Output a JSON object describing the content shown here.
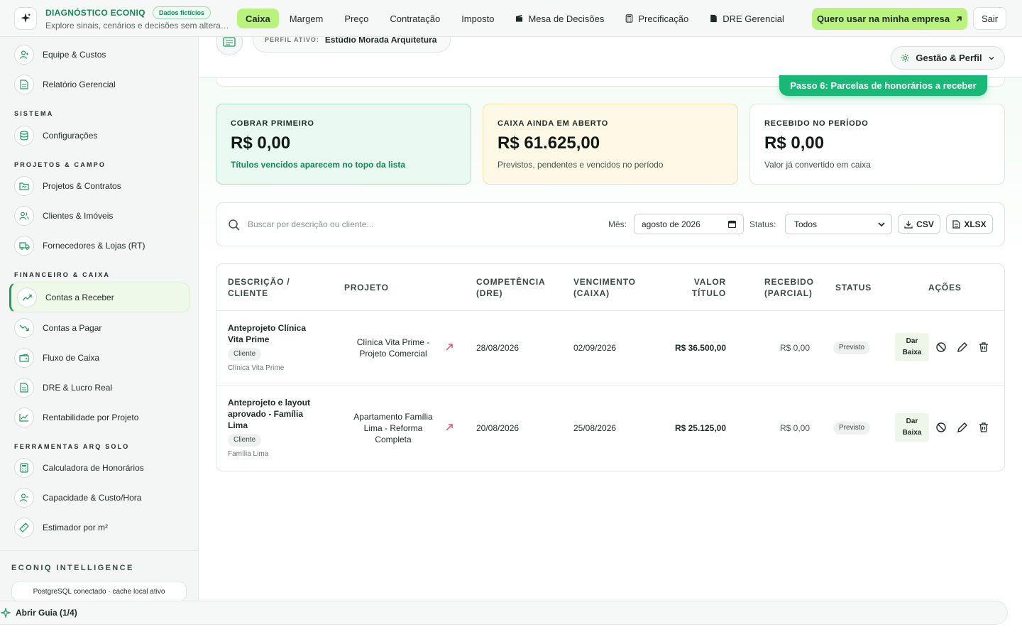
{
  "header": {
    "brand_title": "DIAGNÓSTICO ECONIQ",
    "badge": "Dados fictícios",
    "subtitle": "Explore sinais, cenários e decisões sem alterar dados reais",
    "nav": [
      {
        "label": "Caixa",
        "active": true
      },
      {
        "label": "Margem"
      },
      {
        "label": "Preço"
      },
      {
        "label": "Contratação"
      },
      {
        "label": "Imposto"
      },
      {
        "label": "Mesa de Decisões",
        "icon": "clapperboard-icon"
      },
      {
        "label": "Precificação",
        "icon": "calculator-icon"
      },
      {
        "label": "DRE Gerencial",
        "icon": "document-icon"
      }
    ],
    "cta": "Quero usar na minha empresa",
    "logout": "Sair"
  },
  "sidebar": {
    "items_top": [
      {
        "label": "Equipe & Custos",
        "icon": "user-gear-icon"
      },
      {
        "label": "Relatório Gerencial",
        "icon": "report-icon"
      }
    ],
    "sections": [
      {
        "title": "SISTEMA",
        "items": [
          {
            "label": "Configurações",
            "icon": "database-icon"
          }
        ]
      },
      {
        "title": "PROJETOS & CAMPO",
        "items": [
          {
            "label": "Projetos & Contratos",
            "icon": "folder-icon"
          },
          {
            "label": "Clientes & Imóveis",
            "icon": "users-icon"
          },
          {
            "label": "Fornecedores & Lojas (RT)",
            "icon": "truck-icon"
          }
        ]
      },
      {
        "title": "FINANCEIRO & CAIXA",
        "items": [
          {
            "label": "Contas a Receber",
            "icon": "trending-up-icon",
            "active": true
          },
          {
            "label": "Contas a Pagar",
            "icon": "trending-down-icon"
          },
          {
            "label": "Fluxo de Caixa",
            "icon": "wallet-icon"
          },
          {
            "label": "DRE & Lucro Real",
            "icon": "report-icon"
          },
          {
            "label": "Rentabilidade por Projeto",
            "icon": "line-chart-icon"
          }
        ]
      },
      {
        "title": "FERRAMENTAS ARQ SOLO",
        "items": [
          {
            "label": "Calculadora de Honorários",
            "icon": "calculator-icon"
          },
          {
            "label": "Capacidade & Custo/Hora",
            "icon": "user-clock-icon"
          },
          {
            "label": "Estimador por m²",
            "icon": "ruler-icon"
          }
        ]
      }
    ],
    "intel_title": "ECONIQ INTELLIGENCE",
    "db_status": "PostgreSQL conectado · cache local ativo"
  },
  "profile": {
    "label": "PERFIL ATIVO:",
    "value": "Estúdio Morada Arquitetura",
    "menu": "Gestão & Perfil"
  },
  "step_badge": "Passo 6: Parcelas de honorários a receber",
  "kpis": [
    {
      "label": "COBRAR PRIMEIRO",
      "value": "R$ 0,00",
      "desc": "Títulos vencidos aparecem no topo da lista"
    },
    {
      "label": "CAIXA AINDA EM ABERTO",
      "value": "R$ 61.625,00",
      "desc": "Previstos, pendentes e vencidos no período"
    },
    {
      "label": "RECEBIDO NO PERÍODO",
      "value": "R$ 0,00",
      "desc": "Valor já convertido em caixa"
    }
  ],
  "filters": {
    "search_placeholder": "Buscar por descrição ou cliente...",
    "month_label": "Mês:",
    "month_value": "agosto de 2026",
    "status_label": "Status:",
    "status_value": "Todos",
    "csv": "CSV",
    "xlsx": "XLSX"
  },
  "table": {
    "headers": {
      "desc_1": "DESCRIÇÃO /",
      "desc_2": "CLIENTE",
      "projeto": "PROJETO",
      "comp_1": "COMPETÊNCIA",
      "comp_2": "(DRE)",
      "venc_1": "VENCIMENTO",
      "venc_2": "(CAIXA)",
      "valor_1": "VALOR",
      "valor_2": "TÍTULO",
      "rec_1": "RECEBIDO",
      "rec_2": "(PARCIAL)",
      "status": "STATUS",
      "acoes": "AÇÕES"
    },
    "rows": [
      {
        "desc_1": "Anteprojeto Clínica",
        "desc_2": "Vita Prime",
        "chip": "Cliente",
        "client": "Clínica Vita Prime",
        "proj_1": "Clínica Vita Prime -",
        "proj_2": "Projeto Comercial",
        "competencia": "28/08/2026",
        "vencimento": "02/09/2026",
        "valor": "R$ 36.500,00",
        "recebido": "R$ 0,00",
        "status": "Previsto",
        "baixa_1": "Dar",
        "baixa_2": "Baixa"
      },
      {
        "desc_1": "Anteprojeto e layout",
        "desc_2": "aprovado - Família",
        "desc_3": "Lima",
        "chip": "Cliente",
        "client": "Família Lima",
        "proj_1": "Apartamento Família",
        "proj_2": "Lima - Reforma",
        "proj_3": "Completa",
        "competencia": "20/08/2026",
        "vencimento": "25/08/2026",
        "valor": "R$ 25.125,00",
        "recebido": "R$ 0,00",
        "status": "Previsto",
        "baixa_1": "Dar",
        "baixa_2": "Baixa"
      }
    ]
  },
  "guide": "Abrir Guia (1/4)",
  "colors": {
    "accent": "#b9f27c",
    "brand": "#128a55",
    "step": "#18b877"
  }
}
